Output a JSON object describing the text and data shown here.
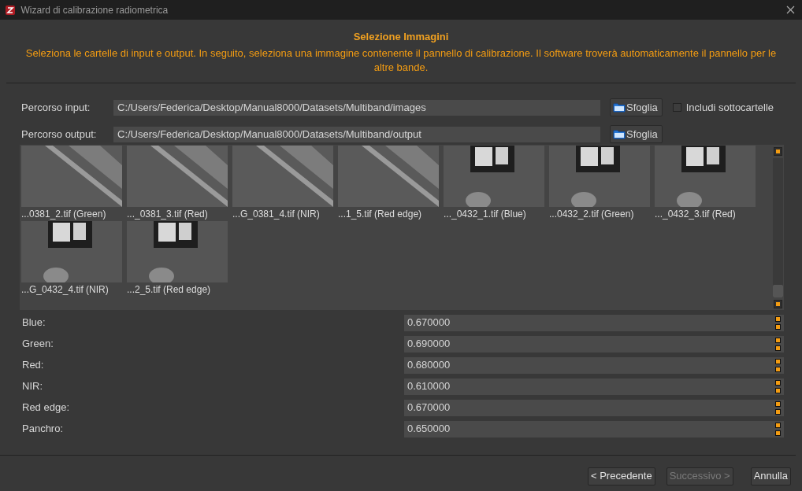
{
  "window": {
    "title": "Wizard di calibrazione radiometrica"
  },
  "header": {
    "title": "Selezione Immagini",
    "description": "Seleziona le cartelle di input e output. In seguito, seleziona una immagine contenente il pannello di calibrazione. Il software troverà automaticamente il pannello per le altre bande."
  },
  "paths": [
    {
      "label": "Percorso input:",
      "value": "C:/Users/Federica/Desktop/Manual8000/Datasets/Multiband/images",
      "button": "Sfoglia",
      "checkbox": {
        "label": "Includi sottocartelle",
        "checked": false
      }
    },
    {
      "label": "Percorso output:",
      "value": "C:/Users/Federica/Desktop/Manual8000/Datasets/Multiband/output",
      "button": "Sfoglia"
    }
  ],
  "thumbnails": [
    {
      "kind": "field",
      "caption": "...0381_2.tif (Green)"
    },
    {
      "kind": "field",
      "caption": "..._0381_3.tif (Red)"
    },
    {
      "kind": "field",
      "caption": "...G_0381_4.tif (NIR)"
    },
    {
      "kind": "field",
      "caption": "...1_5.tif (Red edge)"
    },
    {
      "kind": "panel",
      "caption": "..._0432_1.tif (Blue)"
    },
    {
      "kind": "panel",
      "caption": "...0432_2.tif (Green)"
    },
    {
      "kind": "panel",
      "caption": "..._0432_3.tif (Red)"
    },
    {
      "kind": "panel",
      "caption": "...G_0432_4.tif (NIR)"
    },
    {
      "kind": "panel",
      "caption": "...2_5.tif (Red edge)"
    }
  ],
  "bands": [
    {
      "label": "Blue:",
      "value": "0.670000"
    },
    {
      "label": "Green:",
      "value": "0.690000"
    },
    {
      "label": "Red:",
      "value": "0.680000"
    },
    {
      "label": "NIR:",
      "value": "0.610000"
    },
    {
      "label": "Red edge:",
      "value": "0.670000"
    },
    {
      "label": "Panchro:",
      "value": "0.650000"
    }
  ],
  "buttons": [
    {
      "label": "< Precedente",
      "disabled": false
    },
    {
      "label": "Successivo >",
      "disabled": true
    },
    {
      "label": "Annulla",
      "disabled": false
    }
  ]
}
